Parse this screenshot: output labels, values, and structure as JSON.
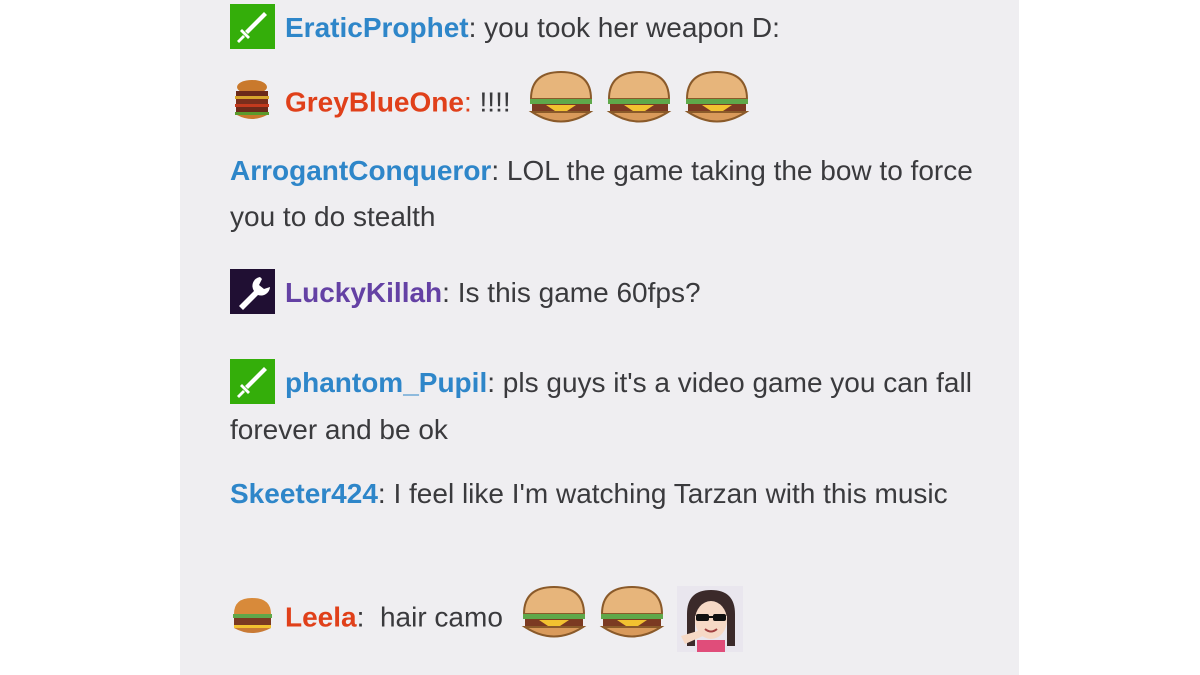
{
  "colors": {
    "panel_bg": "#efeef1",
    "text": "#3a3a3d",
    "blue_user": "#2e86c9",
    "red_user": "#e0401a",
    "purple_user": "#6441a4",
    "moderator_badge": "#34ae0a",
    "staff_badge": "#200f33"
  },
  "messages": [
    {
      "username": "EraticProphet",
      "separator": ":",
      "text": " you took her weapon D:",
      "badge": "moderator-sword-icon",
      "emotes": []
    },
    {
      "username": "GreyBlueOne",
      "separator": ":",
      "text": " !!!!",
      "badge": "burger-stack-avatar-icon",
      "emotes": [
        "burger-emote",
        "burger-emote",
        "burger-emote"
      ]
    },
    {
      "username": "ArrogantConqueror",
      "separator": ":",
      "text": " LOL the game taking the bow to force you to do stealth",
      "badge": "",
      "emotes": []
    },
    {
      "username": "LuckyKillah",
      "separator": ":",
      "text": " Is this game 60fps?",
      "badge": "staff-wrench-icon",
      "emotes": []
    },
    {
      "username": "phantom_Pupil",
      "separator": ":",
      "text": " pls guys it's a video game you can fall forever and be ok",
      "badge": "moderator-sword-icon",
      "emotes": []
    },
    {
      "username": "Skeeter424",
      "separator": ":",
      "text": " I feel like I'm watching Tarzan with this music",
      "badge": "",
      "emotes": []
    },
    {
      "username": "Leela",
      "separator": ":",
      "text": "  hair camo",
      "badge": "burger-avatar-icon",
      "emotes": [
        "burger-emote",
        "burger-emote",
        "sunglasses-girl-emote"
      ]
    }
  ]
}
